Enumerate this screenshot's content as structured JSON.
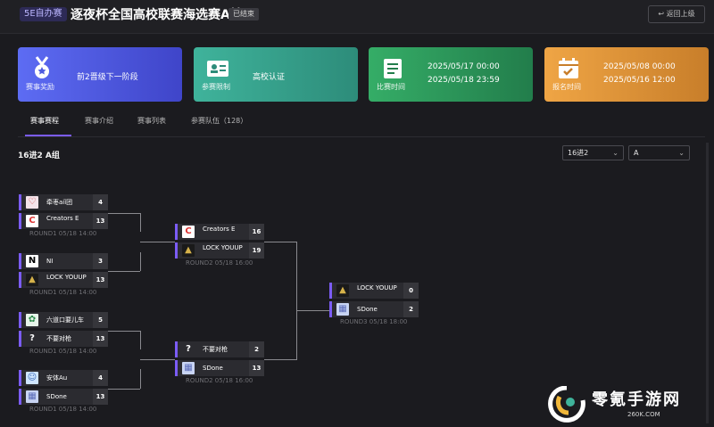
{
  "header": {
    "badge": "5E自办赛",
    "title": "逐夜杯全国高校联赛海选赛A轮",
    "status": "已结束",
    "back_label": "返回上级"
  },
  "cards": [
    {
      "label": "赛事奖励",
      "lines": [
        "前2晋级下一阶段"
      ],
      "icon": "medal-icon"
    },
    {
      "label": "参赛限制",
      "lines": [
        "高校认证"
      ],
      "icon": "id-card-icon"
    },
    {
      "label": "比赛时间",
      "lines": [
        "2025/05/17 00:00",
        "2025/05/18 23:59"
      ],
      "icon": "document-icon"
    },
    {
      "label": "报名时间",
      "lines": [
        "2025/05/08 00:00",
        "2025/05/16 12:00"
      ],
      "icon": "calendar-check-icon"
    }
  ],
  "tabs": [
    "赛事赛程",
    "赛事介绍",
    "赛事列表",
    "参赛队伍（128）"
  ],
  "group_title": "16进2 A组",
  "selects": {
    "stage": "16进2",
    "group": "A"
  },
  "matches": [
    {
      "teams": [
        {
          "name": "牵枣aiǐ团",
          "score": "4",
          "logo": "custom-team-logo"
        },
        {
          "name": "Creators E",
          "score": "13",
          "logo": "creators-logo"
        }
      ],
      "info": "ROUND1 05/18 14:00"
    },
    {
      "teams": [
        {
          "name": "NI",
          "score": "3",
          "logo": "ni-logo"
        },
        {
          "name": "LOCK YOUUP",
          "score": "13",
          "logo": "lock-logo"
        }
      ],
      "info": "ROUND1 05/18 14:00"
    },
    {
      "teams": [
        {
          "name": "六道口要儿车",
          "score": "5",
          "logo": "leaf-logo"
        },
        {
          "name": "不要对枪",
          "score": "13",
          "logo": "question-logo"
        }
      ],
      "info": "ROUND1 05/18 14:00"
    },
    {
      "teams": [
        {
          "name": "安体Au",
          "score": "4",
          "logo": "anime-logo"
        },
        {
          "name": "SDone",
          "score": "13",
          "logo": "sdone-logo"
        }
      ],
      "info": "ROUND1 05/18 14:00"
    },
    {
      "teams": [
        {
          "name": "Creators E",
          "score": "16",
          "logo": "creators-logo"
        },
        {
          "name": "LOCK YOUUP",
          "score": "19",
          "logo": "lock-logo"
        }
      ],
      "info": "ROUND2 05/18 16:00"
    },
    {
      "teams": [
        {
          "name": "不要对枪",
          "score": "2",
          "logo": "question-logo"
        },
        {
          "name": "SDone",
          "score": "13",
          "logo": "sdone-logo"
        }
      ],
      "info": "ROUND2 05/18 16:00"
    },
    {
      "teams": [
        {
          "name": "LOCK YOUUP",
          "score": "0",
          "logo": "lock-logo"
        },
        {
          "name": "SDone",
          "score": "2",
          "logo": "sdone-logo"
        }
      ],
      "info": "ROUND3 05/18 18:00"
    }
  ],
  "watermark": {
    "text": "零氪手游网",
    "url": "260K.COM"
  },
  "colors": {
    "accent": "#7b5cf5",
    "card1": "#5d6cf3",
    "card2": "#3fb39b",
    "card3": "#35ad67",
    "card4": "#efa545"
  }
}
